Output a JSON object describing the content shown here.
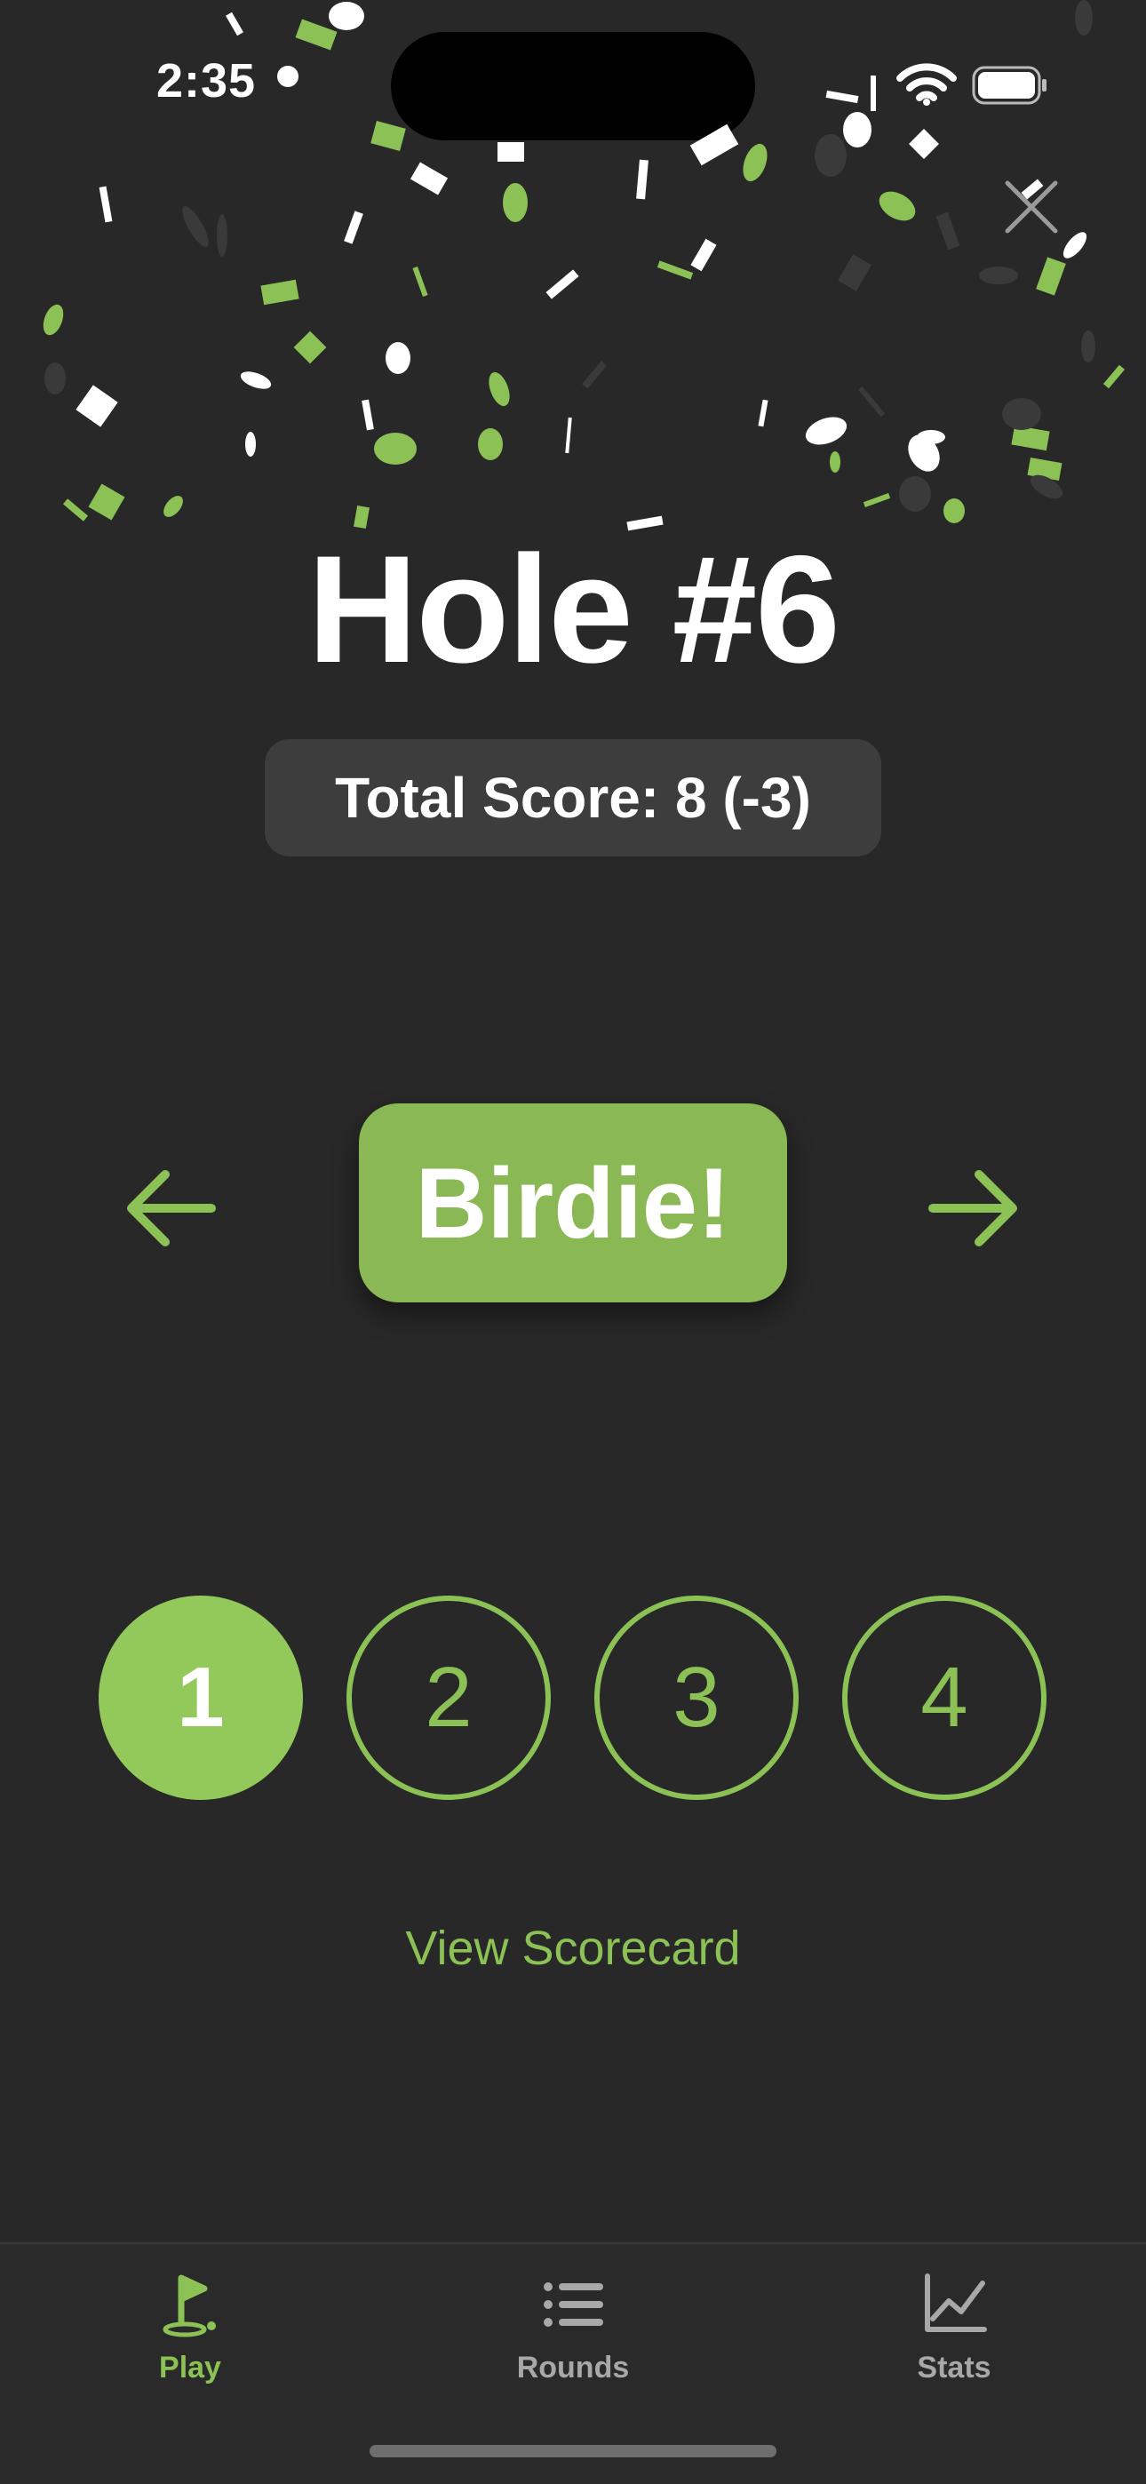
{
  "status_bar": {
    "time": "2:35"
  },
  "hole": {
    "title": "Hole #6"
  },
  "score": {
    "total_text": "Total Score: 8 (-3)"
  },
  "result": {
    "label": "Birdie!"
  },
  "putts": {
    "options": [
      "1",
      "2",
      "3",
      "4"
    ],
    "selected": "1"
  },
  "links": {
    "view_scorecard": "View Scorecard"
  },
  "tab_bar": {
    "tabs": [
      {
        "label": "Play",
        "icon": "golf-flag-icon",
        "active": true
      },
      {
        "label": "Rounds",
        "icon": "list-icon",
        "active": false
      },
      {
        "label": "Stats",
        "icon": "line-chart-icon",
        "active": false
      }
    ]
  },
  "colors": {
    "background": "#282828",
    "accent": "#8bc155",
    "accent_fill": "#93c95b",
    "badge": "#8ab854",
    "pill": "#3d3d3d",
    "inactive": "#a8a8a8"
  }
}
